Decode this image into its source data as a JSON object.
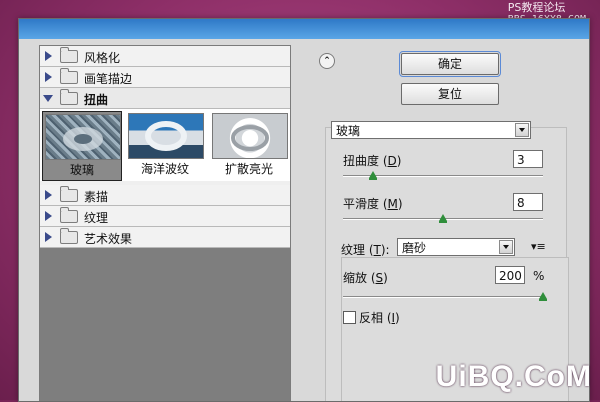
{
  "watermarks": {
    "top_line1": "PS教程论坛",
    "top_line2": "BBS.16XX8.COM",
    "bottom": "UiBQ.CoM"
  },
  "filter_list": {
    "categories": [
      {
        "label": "风格化",
        "expanded": false
      },
      {
        "label": "画笔描边",
        "expanded": false
      },
      {
        "label": "扭曲",
        "expanded": true
      },
      {
        "label": "素描",
        "expanded": false
      },
      {
        "label": "纹理",
        "expanded": false
      },
      {
        "label": "艺术效果",
        "expanded": false
      }
    ],
    "distort_filters": [
      {
        "label": "玻璃",
        "selected": true
      },
      {
        "label": "海洋波纹",
        "selected": false
      },
      {
        "label": "扩散亮光",
        "selected": false
      }
    ]
  },
  "buttons": {
    "ok": "确定",
    "reset": "复位",
    "collapse_glyph": "⌃"
  },
  "filter_select": {
    "value": "玻璃"
  },
  "params": {
    "distortion": {
      "label": "扭曲度 (",
      "key": "D",
      "close": ")",
      "value": "3",
      "range": [
        0,
        20
      ]
    },
    "smoothness": {
      "label": "平滑度 (",
      "key": "M",
      "close": ")",
      "value": "8",
      "range": [
        1,
        15
      ]
    },
    "texture": {
      "label": "纹理 (",
      "key": "T",
      "close": "):",
      "value": "磨砂"
    },
    "scaling": {
      "label": "缩放 (",
      "key": "S",
      "close": ")",
      "value": "200",
      "unit": "%",
      "range": [
        50,
        200
      ]
    },
    "invert": {
      "label": "反相 (",
      "key": "I",
      "close": ")",
      "checked": false
    }
  },
  "texture_menu_glyph": "▾≡",
  "colors": {
    "background": "#9a3a74",
    "titlebar": "#3f8fd6",
    "slider_knob": "#2f8e3b"
  }
}
